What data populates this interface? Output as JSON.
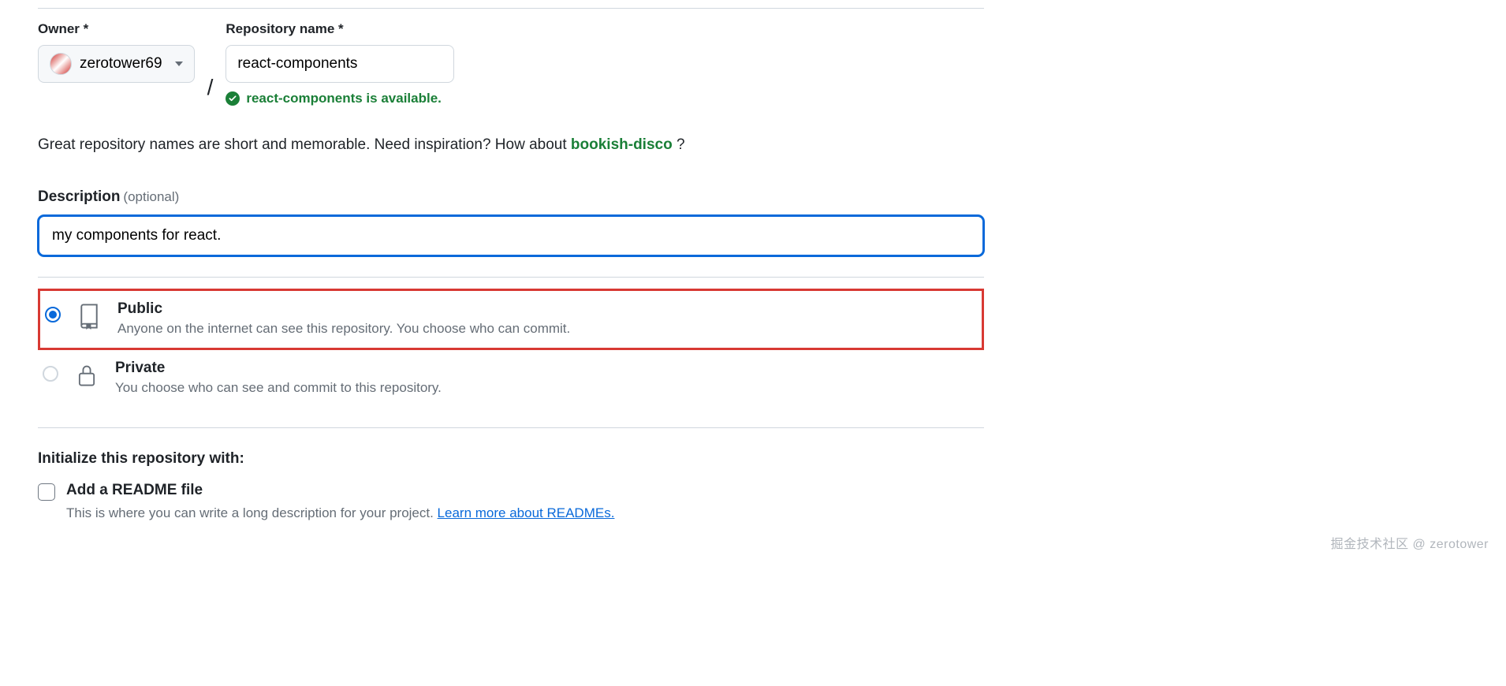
{
  "form": {
    "owner_label": "Owner *",
    "owner_name": "zerotower69",
    "repo_label": "Repository name *",
    "repo_value": "react-components",
    "slash": "/",
    "availability_text": "react-components is available.",
    "inspiration_prefix": "Great repository names are short and memorable. Need inspiration? How about ",
    "suggestion": "bookish-disco",
    "inspiration_suffix": " ?",
    "desc_label": "Description",
    "desc_optional": "(optional)",
    "desc_value": "my components for react.",
    "visibility": {
      "public": {
        "title": "Public",
        "desc": "Anyone on the internet can see this repository. You choose who can commit."
      },
      "private": {
        "title": "Private",
        "desc": "You choose who can see and commit to this repository."
      }
    },
    "init_heading": "Initialize this repository with:",
    "readme": {
      "label": "Add a README file",
      "desc_prefix": "This is where you can write a long description for your project. ",
      "link": "Learn more about READMEs."
    }
  },
  "watermark": "掘金技术社区 @ zerotower"
}
